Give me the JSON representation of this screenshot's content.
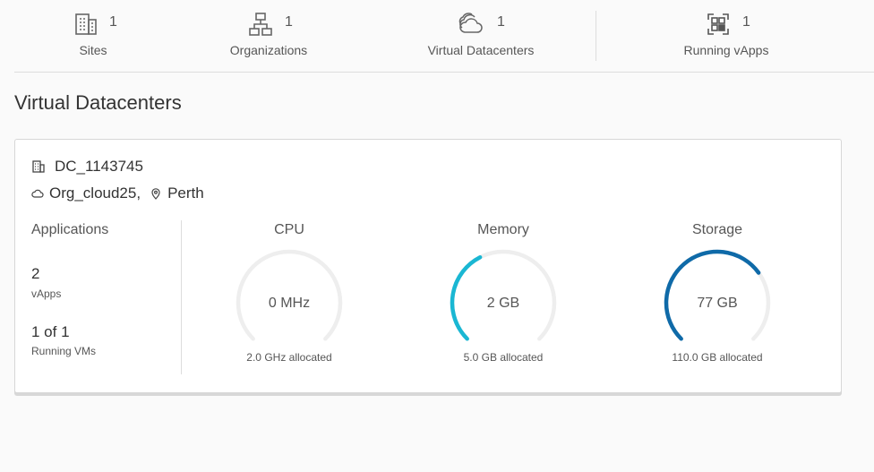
{
  "stats": {
    "sites": {
      "count": "1",
      "label": "Sites",
      "icon": "building-icon"
    },
    "organizations": {
      "count": "1",
      "label": "Organizations",
      "icon": "org-tree-icon"
    },
    "virtual_datacenters": {
      "count": "1",
      "label": "Virtual Datacenters",
      "icon": "clouds-icon"
    },
    "running_vapps": {
      "count": "1",
      "label": "Running vApps",
      "icon": "vapp-icon"
    }
  },
  "section_title": "Virtual Datacenters",
  "card": {
    "name": "DC_1143745",
    "org": "Org_cloud25,",
    "location": "Perth",
    "applications": {
      "title": "Applications",
      "vapps_value": "2",
      "vapps_label": "vApps",
      "vms_value": "1 of 1",
      "vms_label": "Running VMs"
    },
    "gauges": [
      {
        "title": "CPU",
        "value": "0 MHz",
        "allocated": "2.0 GHz allocated",
        "fraction": 0.0,
        "color": "#00b7d6"
      },
      {
        "title": "Memory",
        "value": "2 GB",
        "allocated": "5.0 GB allocated",
        "fraction": 0.4,
        "color": "#1ab7d3"
      },
      {
        "title": "Storage",
        "value": "77 GB",
        "allocated": "110.0 GB allocated",
        "fraction": 0.7,
        "color": "#0f6aa8"
      }
    ]
  },
  "colors": {
    "gauge_track": "#eeeeee",
    "divider": "#dddddd"
  }
}
